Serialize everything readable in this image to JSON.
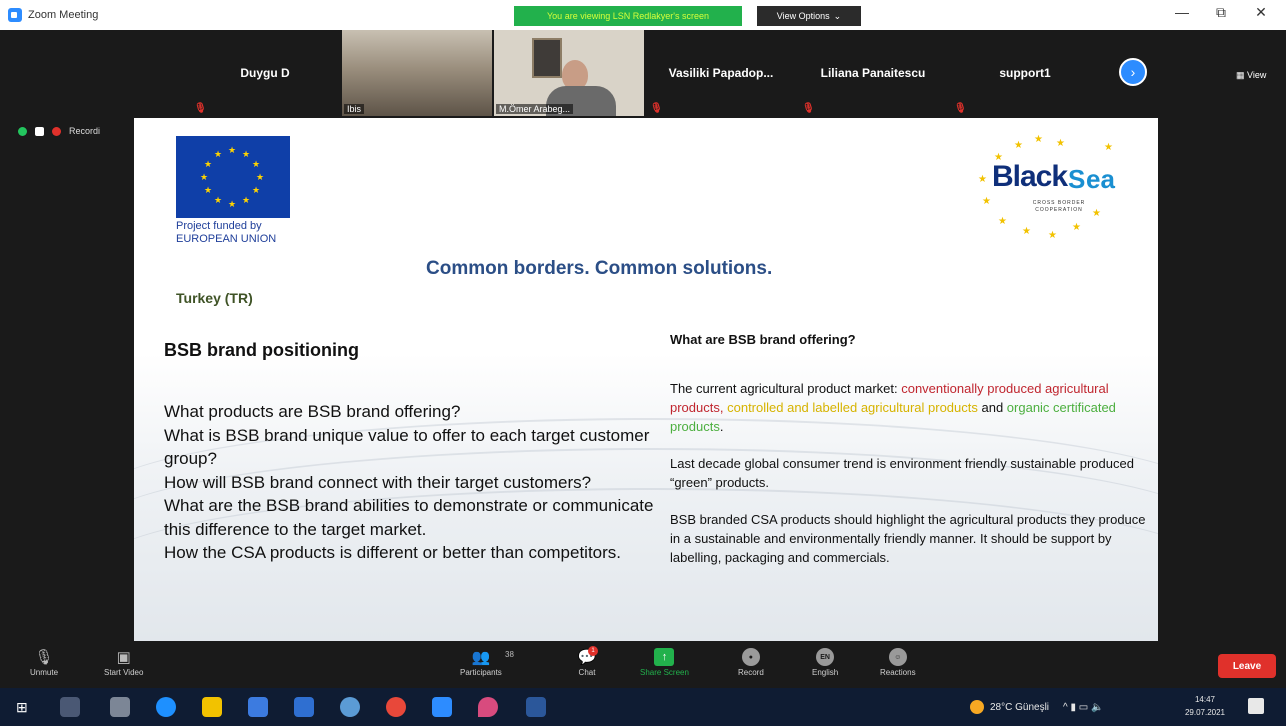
{
  "window": {
    "title": "Zoom Meeting",
    "share_banner": "You are viewing LSN Redlakyer's screen",
    "view_options": "View Options",
    "view_options_caret": "⌄",
    "minimize": "—",
    "maximize": "⧉",
    "close": "✕"
  },
  "gallery": {
    "participants": [
      {
        "name": "Duygu D",
        "muted": true
      },
      {
        "name": "Ibis",
        "muted": false
      },
      {
        "name": "M.Ömer Arabeg...",
        "muted": false
      },
      {
        "name": "Vasiliki  Papadop...",
        "muted": true
      },
      {
        "name": "Liliana Panaitescu",
        "muted": true
      },
      {
        "name": "support1",
        "muted": true
      }
    ],
    "next_arrow": "›",
    "view_label": "View"
  },
  "recording": {
    "label": "Recordi"
  },
  "slide": {
    "eu_caption_line1": "Project  funded  by",
    "eu_caption_line2": "EUROPEAN UNION",
    "logo_word_black": "Black",
    "logo_word_sea": "ea",
    "logo_s": "S",
    "logo_sub": "CROSS BORDER COOPERATION",
    "title": "Common borders. Common solutions.",
    "country": "Turkey (TR)",
    "left_heading": "BSB brand  positioning",
    "left_lines": [
      "What products are BSB brand offering?",
      "What is BSB brand unique value to offer to each target customer group?",
      "How will BSB brand connect with their target customers?",
      "What are the BSB brand abilities to demonstrate or communicate this difference to the target market.",
      "How the CSA products is different or better than competitors."
    ],
    "right_heading": "What are BSB brand offering?",
    "right_p1_prefix": "The current agricultural product market: ",
    "right_p1_red": "conventionally produced agricultural products,",
    "right_p1_yellow": "controlled and labelled agricultural products",
    "right_p1_and": " and ",
    "right_p1_green": "organic certificated products",
    "right_p1_end": ".",
    "right_p2": "Last decade global consumer trend is environment friendly sustainable produced “green” products.",
    "right_p3": "BSB branded CSA products should highlight the agricultural products they produce in a sustainable and environmentally friendly manner. It should be support by labelling, packaging and commercials."
  },
  "toolbar": {
    "unmute": "Unmute",
    "start_video": "Start Video",
    "participants": "Participants",
    "participants_count": "38",
    "chat": "Chat",
    "chat_badge": "1",
    "share_screen": "Share Screen",
    "record": "Record",
    "english": "English",
    "english_badge": "EN",
    "reactions": "Reactions",
    "leave": "Leave"
  },
  "taskbar": {
    "weather": "28°C  Güneşli",
    "time": "14:47",
    "date": "29.07.2021",
    "tray_icons": "^ ▮ ▭ 🔈"
  },
  "colors": {
    "zoom_blue": "#2d8cff",
    "share_green": "#22b14c",
    "leave_red": "#e0312b",
    "slide_title_blue": "#2b4e86"
  }
}
